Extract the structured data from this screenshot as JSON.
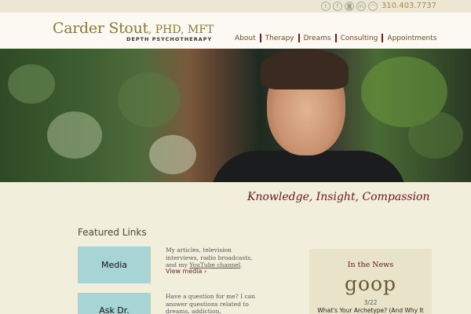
{
  "topbar": {
    "social_icons": [
      {
        "icon": "twitter-icon",
        "glyph": "t"
      },
      {
        "icon": "facebook-icon",
        "glyph": "f"
      },
      {
        "icon": "instagram-icon",
        "glyph": "◙"
      },
      {
        "icon": "linkedin-icon",
        "glyph": "in"
      },
      {
        "icon": "podcast-icon",
        "glyph": "◠"
      }
    ],
    "phone": "310.403.7737"
  },
  "header": {
    "logo_name": "Carder Stout",
    "logo_credentials": ", PHD, MFT",
    "logo_subtitle": "DEPTH PSYCHOTHERAPY",
    "nav": [
      "About",
      "Therapy",
      "Dreams",
      "Consulting",
      "Appointments"
    ]
  },
  "hero": {
    "tagline": "Knowledge, Insight, Compassion"
  },
  "featured": {
    "title": "Featured Links",
    "items": [
      {
        "label": "Media",
        "desc_prefix": "My articles, television interviews, radio broadcasts, and my ",
        "desc_link": "YouTube channel",
        "desc_suffix": ".",
        "link": "View media ›"
      },
      {
        "label": "Ask Dr.",
        "desc_prefix": "Have a question for me? I can answer questions related to dreams, addiction, relationships and more.",
        "desc_link": "",
        "desc_suffix": ""
      }
    ]
  },
  "news": {
    "title": "In the News",
    "logo": "goop",
    "date": "3/22",
    "headline": "What's Your Archetype? (And Why It"
  },
  "colors": {
    "background": "#f2eedc",
    "accent": "#6a1520",
    "card": "#a7d4d4",
    "logo": "#8a7a36"
  }
}
